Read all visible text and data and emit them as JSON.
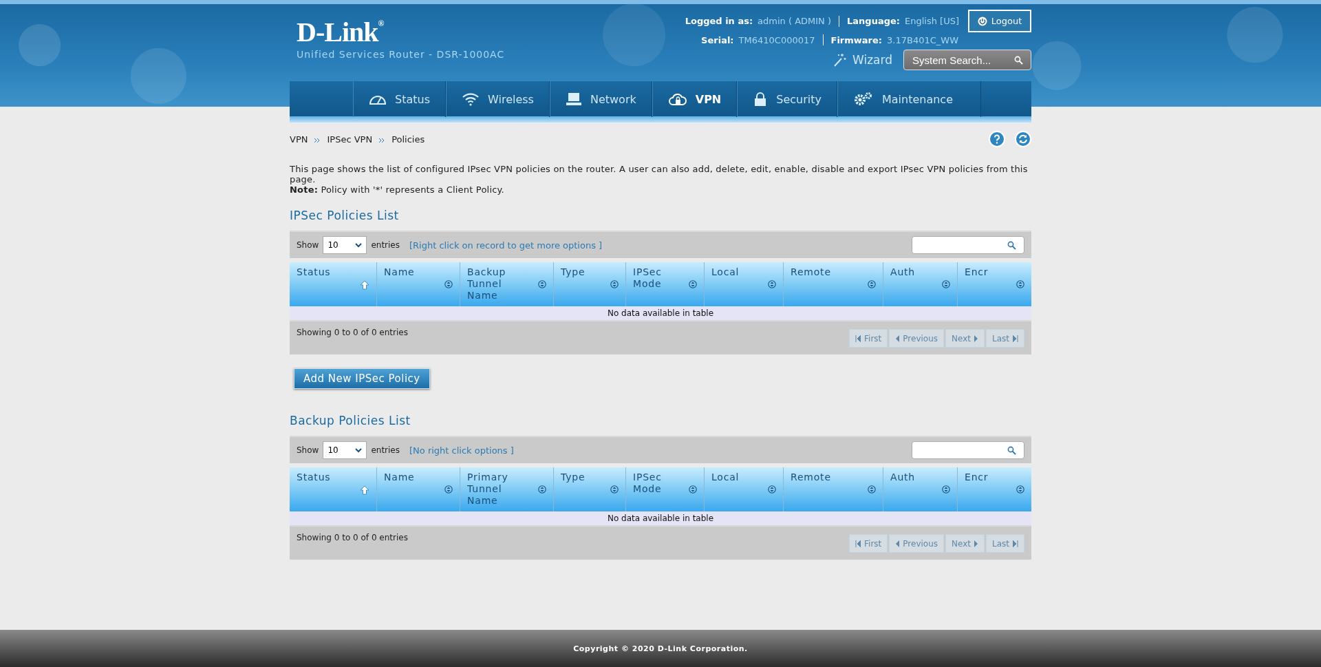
{
  "header": {
    "logo": "D-Link$^{®}$",
    "subtitle": "Unified Services Router - DSR-1000AC",
    "info": [
      {
        "label": "Logged in as:",
        "value": "admin ( ADMIN )"
      },
      {
        "label": "Language:",
        "value": "English [US]"
      }
    ],
    "info2": [
      {
        "label": "Serial:",
        "value": "TM6410C000017"
      },
      {
        "label": "Firmware:",
        "value": "3.17B401C_WW"
      }
    ],
    "logout": "Logout",
    "wizard": "Wizard",
    "search": {
      "placeholder": "System Search..."
    }
  },
  "nav": [
    {
      "label": "Status",
      "kind": "gauge",
      "selected": false
    },
    {
      "label": "Wireless",
      "kind": "wifi",
      "selected": false
    },
    {
      "label": "Network",
      "kind": "computer",
      "selected": false
    },
    {
      "label": "VPN",
      "kind": "cloud",
      "selected": true
    },
    {
      "label": "Security",
      "kind": "lock",
      "selected": false
    },
    {
      "label": "Maintenance",
      "kind": "gears",
      "selected": false
    }
  ],
  "breadcrumb": [
    "VPN",
    "IPSec VPN",
    "Policies"
  ],
  "description": "This page shows the list of configured IPsec VPN policies on the router. A user can also add, delete, edit, enable, disable and export IPsec VPN policies from this page.",
  "note": "**Note:** Policy with '*' represents a Client Policy.",
  "tables": [
    {
      "title": "IPSec Policies List",
      "show": "Show",
      "page_size": "10",
      "entries": "entries",
      "hint": "[Right click on record to get more options ]",
      "columns": [
        {
          "label": "Status",
          "sorted": true
        },
        {
          "label": "Name",
          "sorted": false
        },
        {
          "label": "Backup Tunnel Name",
          "sorted": false
        },
        {
          "label": "Type",
          "sorted": false
        },
        {
          "label": "IPSec Mode",
          "sorted": false
        },
        {
          "label": "Local",
          "sorted": false
        },
        {
          "label": "Remote",
          "sorted": false
        },
        {
          "label": "Auth",
          "sorted": false
        },
        {
          "label": "Encr",
          "sorted": false
        }
      ],
      "empty": "No data available in table",
      "info": "Showing 0 to 0 of 0 entries",
      "pager": [
        {
          "label": "First",
          "kind": "first",
          "disabled": true
        },
        {
          "label": "Previous",
          "kind": "prev",
          "disabled": true
        },
        {
          "label": "Next",
          "kind": "next",
          "disabled": true
        },
        {
          "label": "Last",
          "kind": "last",
          "disabled": true
        }
      ],
      "button": "Add New IPSec Policy"
    },
    {
      "title": "Backup Policies List",
      "show": "Show",
      "page_size": "10",
      "entries": "entries",
      "hint": "[No right click options ]",
      "columns": [
        {
          "label": "Status",
          "sorted": true
        },
        {
          "label": "Name",
          "sorted": false
        },
        {
          "label": "Primary Tunnel Name",
          "sorted": false
        },
        {
          "label": "Type",
          "sorted": false
        },
        {
          "label": "IPSec Mode",
          "sorted": false
        },
        {
          "label": "Local",
          "sorted": false
        },
        {
          "label": "Remote",
          "sorted": false
        },
        {
          "label": "Auth",
          "sorted": false
        },
        {
          "label": "Encr",
          "sorted": false
        }
      ],
      "empty": "No data available in table",
      "info": "Showing 0 to 0 of 0 entries",
      "pager": [
        {
          "label": "First",
          "kind": "first",
          "disabled": true
        },
        {
          "label": "Previous",
          "kind": "prev",
          "disabled": true
        },
        {
          "label": "Next",
          "kind": "next",
          "disabled": true
        },
        {
          "label": "Last",
          "kind": "last",
          "disabled": true
        }
      ]
    }
  ],
  "footer": "Copyright © 2020 D-Link Corporation."
}
